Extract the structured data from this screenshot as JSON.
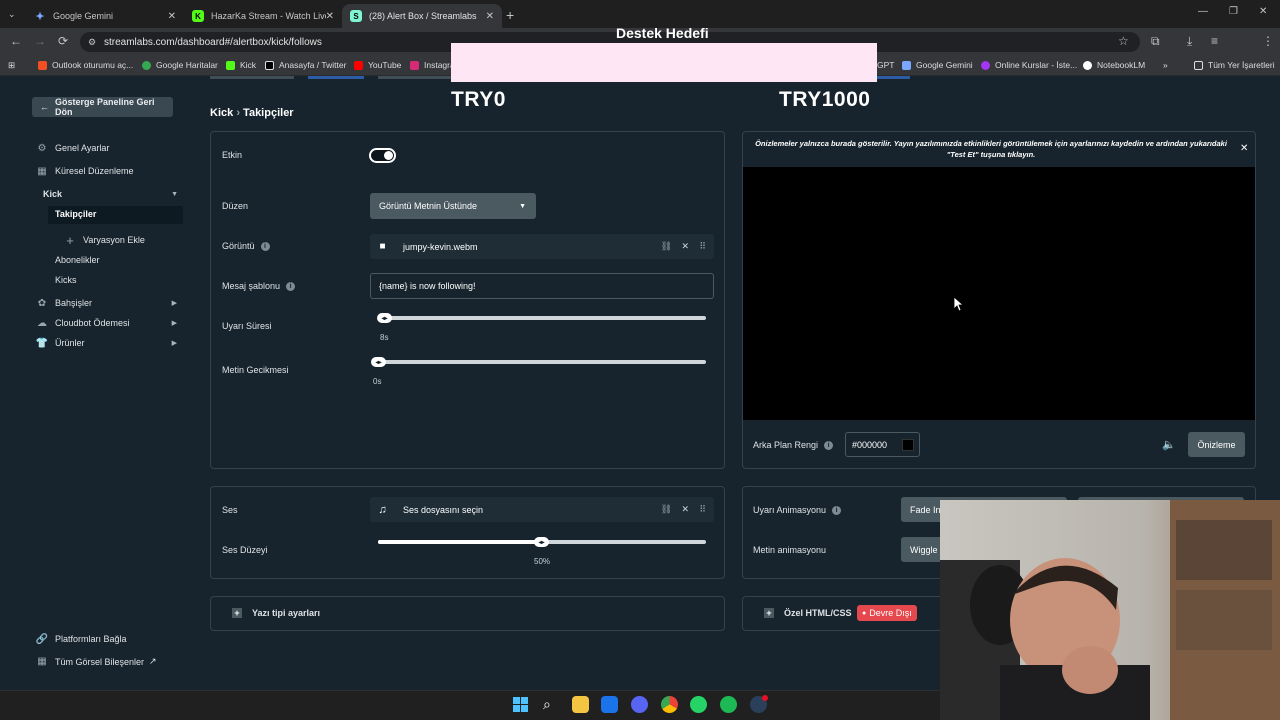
{
  "browser": {
    "tabs": [
      {
        "title": "Google Gemini"
      },
      {
        "title": "HazarKa Stream - Watch Live o"
      },
      {
        "title": "(28) Alert Box / Streamlabs"
      }
    ],
    "url": "streamlabs.com/dashboard#/alertbox/kick/follows",
    "bookmarks": [
      "Outlook oturumu aç...",
      "Google Haritalar",
      "Kick",
      "Anasayfa / Twitter",
      "YouTube",
      "Instagra",
      "GPT",
      "Google Gemini",
      "Online Kurslar - İste...",
      "NotebookLM",
      "Tüm Yer İşaretleri"
    ]
  },
  "overlay": {
    "title": "Destek Hedefi",
    "left_amount": "TRY0",
    "right_amount": "TRY1000"
  },
  "sidebar": {
    "back_label": "Gösterge Paneline Geri Dön",
    "items": [
      "Genel Ayarlar",
      "Küresel Düzenleme",
      "Kick",
      "Takipçiler",
      "Varyasyon Ekle",
      "Abonelikler",
      "Kicks",
      "Bahşişler",
      "Cloudbot Ödemesi",
      "Ürünler"
    ],
    "footer": [
      "Platformları Bağla",
      "Tüm Görsel Bileşenler"
    ]
  },
  "breadcrumb": {
    "parent": "Kick",
    "sep": "›",
    "current": "Takipçiler"
  },
  "settings": {
    "enabled_label": "Etkin",
    "enabled": true,
    "layout_label": "Düzen",
    "layout_value": "Görüntü Metnin Üstünde",
    "image_label": "Görüntü",
    "image_file": "jumpy-kevin.webm",
    "template_label": "Mesaj şablonu",
    "template_value": "{name} is now following!",
    "duration_label": "Uyarı Süresi",
    "duration_value": "8s",
    "duration_level": 0.0,
    "text_delay_label": "Metin Gecikmesi",
    "text_delay_value": "0s",
    "text_delay_level": 0.0
  },
  "sound": {
    "label": "Ses",
    "file_placeholder": "Ses dosyasını seçin",
    "volume_label": "Ses Düzeyi",
    "volume_value": "50%",
    "volume_level": 0.5
  },
  "font_settings": {
    "label": "Yazı tipi ayarları"
  },
  "preview": {
    "note": "Önizlemeler yalnızca burada gösterilir. Yayın yazılımınızda etkinlikleri görüntülemek için ayarlarınızı kaydedin ve ardından yukarıdaki \"Test Et\" tuşuna tıklayın.",
    "bg_label": "Arka Plan Rengi",
    "bg_value": "#000000",
    "preview_button": "Önizleme"
  },
  "animation": {
    "alert_label": "Uyarı Animasyonu",
    "alert_value": "Fade In",
    "text_label": "Metin animasyonu",
    "text_value": "Wiggle"
  },
  "custom": {
    "label": "Özel HTML/CSS",
    "status": "Devre Dışı"
  },
  "colors": {
    "page_bg": "#17242d",
    "card_border": "#33424c",
    "disabled_badge": "#e5484d",
    "overlay_bar": "#ffe6f4"
  },
  "icons": [
    "chrome-down-icon",
    "gemini-icon",
    "kick-icon",
    "streamlabs-icon",
    "back-arrow-icon",
    "reload-icon",
    "star-icon",
    "extensions-icon",
    "download-icon",
    "menu-icon",
    "gear-icon",
    "grid-icon",
    "plus-icon",
    "gift-icon",
    "cloud-icon",
    "shirt-icon",
    "link-icon",
    "external-icon",
    "video-file-icon",
    "music-icon",
    "chain-icon",
    "close-icon",
    "drag-icon",
    "speaker-icon",
    "windows-icon",
    "search-icon",
    "folder-icon",
    "outlook-icon",
    "discord-icon",
    "chrome-icon",
    "whatsapp-icon",
    "spotify-icon",
    "steam-icon"
  ]
}
